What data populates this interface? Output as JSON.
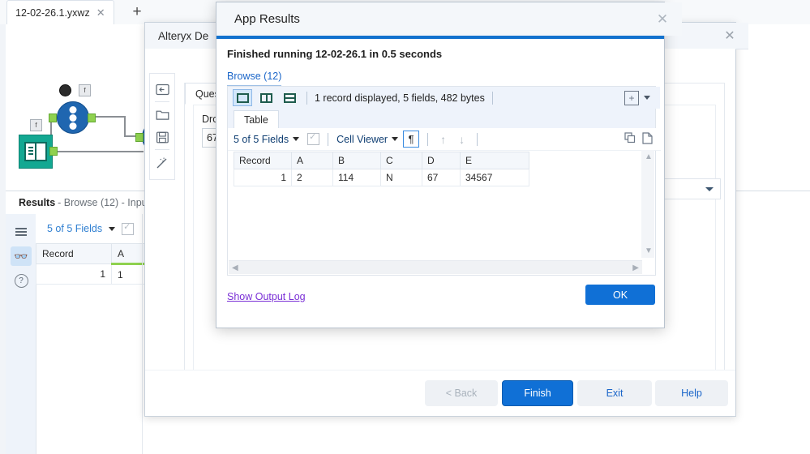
{
  "app": {
    "document_tab": {
      "title": "12-02-26.1.yxwz",
      "close_icon": "close-icon"
    },
    "new_tab_icon": "plus-icon"
  },
  "results_pane": {
    "title": "Results",
    "subtitle": "- Browse (12) - Inpu",
    "icons": [
      "list-icon",
      "binoculars-icon",
      "help-circle-icon"
    ],
    "fields_label": "5 of 5 Fields",
    "columns": [
      "Record",
      "A"
    ],
    "rows": [
      [
        "1",
        "1"
      ]
    ]
  },
  "designer_window": {
    "title": "Alteryx De",
    "close_icon": "close-icon",
    "sidebar_icons": [
      "back-arrow-icon",
      "folder-icon",
      "save-icon",
      "magic-wand-icon"
    ],
    "panel": {
      "tab_label": "Quest",
      "question_label": "Drop",
      "question_value": "67",
      "select_caret_icon": "chevron-down-icon"
    },
    "footer_buttons": [
      {
        "label": "< Back",
        "state": "disabled",
        "style": "secondary"
      },
      {
        "label": "Finish",
        "state": "enabled",
        "style": "primary"
      },
      {
        "label": "Exit",
        "state": "enabled",
        "style": "secondary"
      },
      {
        "label": "Help",
        "state": "enabled",
        "style": "secondary"
      }
    ]
  },
  "modal": {
    "title": "App Results",
    "close_icon": "close-icon",
    "status_message": "Finished running 12-02-26.1 in 0.5 seconds",
    "browse_link": "Browse (12)",
    "browse_panel": {
      "layout_buttons": [
        "single-pane-icon",
        "split-vertical-icon",
        "split-horizontal-icon"
      ],
      "selected_layout": "single-pane-icon",
      "record_summary": "1 record displayed, 5 fields, 482 bytes",
      "add_icon": "plus-box-icon",
      "add_caret_icon": "chevron-down-icon",
      "tab_label": "Table",
      "fields_label": "5 of 5 Fields",
      "fields_caret_icon": "chevron-down-icon",
      "checkbox_icon": "checkbox-icon",
      "viewer_label": "Cell Viewer",
      "viewer_caret_icon": "chevron-down-icon",
      "pilcrow_label": "¶",
      "up_arrow_icon": "arrow-up-icon",
      "down_arrow_icon": "arrow-down-icon",
      "copy_icon": "copy-icon",
      "document_icon": "document-icon",
      "columns": [
        "Record",
        "A",
        "B",
        "C",
        "D",
        "E"
      ],
      "rows": [
        [
          "1",
          "2",
          "114",
          "N",
          "67",
          "34567"
        ]
      ],
      "scroll_up_icon": "scroll-up-icon",
      "scroll_down_icon": "scroll-down-icon",
      "scroll_left_icon": "scroll-left-icon",
      "scroll_right_icon": "scroll-right-icon"
    },
    "show_output_log": "Show Output Log",
    "ok_label": "OK"
  },
  "colors": {
    "accent_blue": "#1272ce",
    "primary_button": "#1070d6",
    "link_blue": "#1b66c9",
    "link_purple": "#7a2fd6",
    "node_blue": "#1f66b0",
    "browse_teal": "#13a892",
    "port_green": "#8fd14f"
  }
}
